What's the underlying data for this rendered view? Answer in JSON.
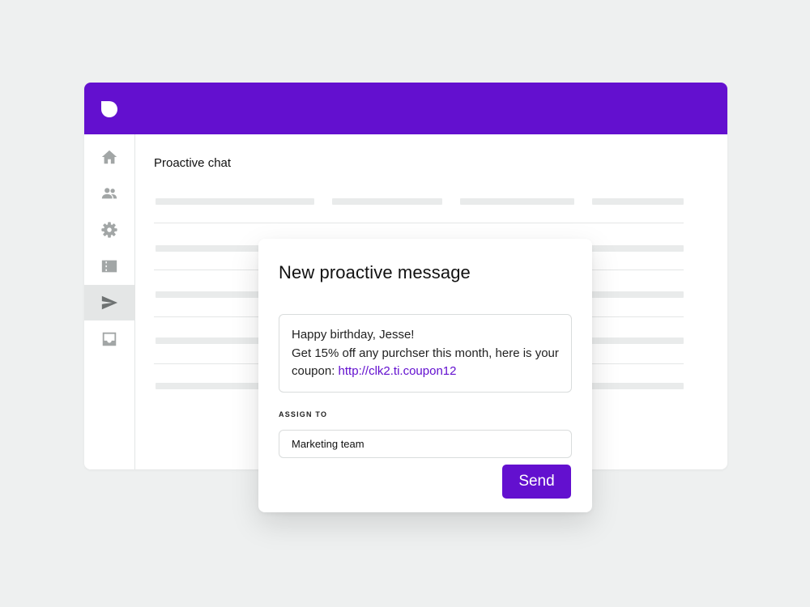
{
  "colors": {
    "brand": "#6310cf",
    "background": "#eef0f0",
    "placeholder": "#e9ebeb"
  },
  "header": {
    "logo_icon": "brand-logo-icon"
  },
  "sidebar": {
    "items": [
      {
        "icon": "home-icon",
        "active": false
      },
      {
        "icon": "users-icon",
        "active": false
      },
      {
        "icon": "gear-icon",
        "active": false
      },
      {
        "icon": "ticket-icon",
        "active": false
      },
      {
        "icon": "send-icon",
        "active": true
      },
      {
        "icon": "inbox-icon",
        "active": false
      }
    ]
  },
  "main": {
    "title": "Proactive chat"
  },
  "modal": {
    "title": "New proactive message",
    "message": {
      "line1": "Happy birthday, Jesse!",
      "line2": "Get 15% off any purchser this month, here is your",
      "line3_prefix": "coupon: ",
      "link": "http://clk2.ti.coupon12"
    },
    "assign_label": "ASSIGN TO",
    "assign_value": "Marketing team",
    "send_label": "Send"
  }
}
